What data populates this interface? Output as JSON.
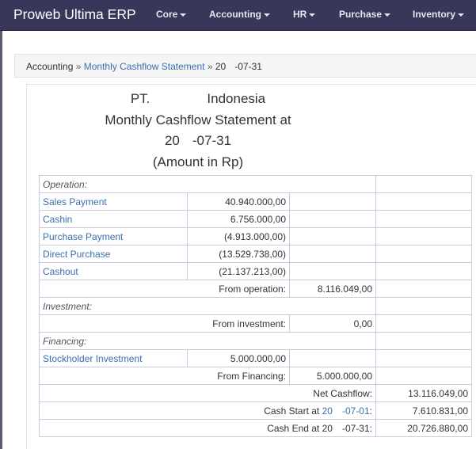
{
  "navbar": {
    "brand": "Proweb Ultima ERP",
    "menus": [
      "Core",
      "Accounting",
      "HR",
      "Purchase",
      "Inventory"
    ]
  },
  "breadcrumb": {
    "root": "Accounting",
    "sep1": "»",
    "link": "Monthly Cashflow Statement",
    "sep2": "»",
    "current_a": "20",
    "current_b": "-07-31"
  },
  "report": {
    "company_a": "PT.",
    "company_b": "Indonesia",
    "title": "Monthly Cashflow Statement at",
    "date_a": "20",
    "date_b": "-07-31",
    "currency_note": "(Amount in Rp)"
  },
  "table": {
    "operation_label": "Operation:",
    "operation_rows": [
      {
        "name": "Sales Payment",
        "amount": "40.940.000,00"
      },
      {
        "name": "Cashin",
        "amount": "6.756.000,00"
      },
      {
        "name": "Purchase Payment",
        "amount": "(4.913.000,00)"
      },
      {
        "name": "Direct Purchase",
        "amount": "(13.529.738,00)"
      },
      {
        "name": "Cashout",
        "amount": "(21.137.213,00)"
      }
    ],
    "from_operation_label": "From operation:",
    "from_operation_value": "8.116.049,00",
    "investment_label": "Investment:",
    "from_investment_label": "From investment:",
    "from_investment_value": "0,00",
    "financing_label": "Financing:",
    "financing_rows": [
      {
        "name": "Stockholder Investment",
        "amount": "5.000.000,00"
      }
    ],
    "from_financing_label": "From Financing:",
    "from_financing_value": "5.000.000,00",
    "net_cashflow_label": "Net Cashflow:",
    "net_cashflow_value": "13.116.049,00",
    "cash_start_prefix": "Cash Start at",
    "cash_start_date_a": "20",
    "cash_start_date_b": "-07-01",
    "cash_start_suffix": ":",
    "cash_start_value": "7.610.831,00",
    "cash_end_prefix": "Cash End at",
    "cash_end_date_a": "20",
    "cash_end_date_b": "-07-31",
    "cash_end_suffix": ":",
    "cash_end_value": "20.726.880,00"
  }
}
